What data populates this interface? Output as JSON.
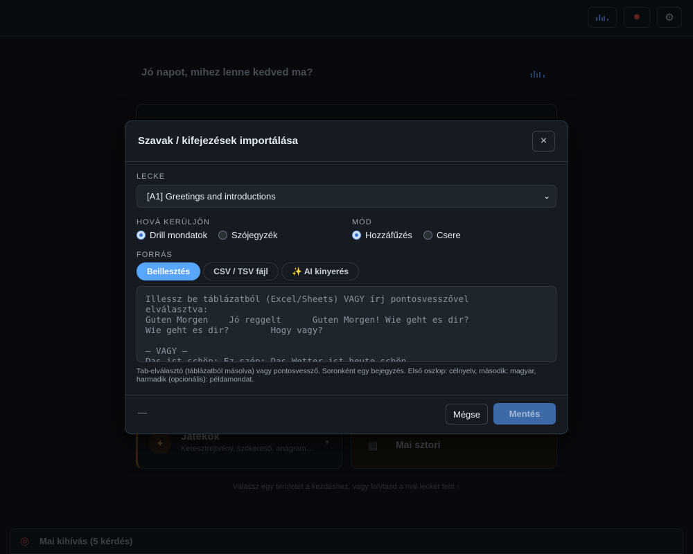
{
  "header": {
    "buttons": [
      {
        "name": "stats-button",
        "icon": "bar-chart-icon"
      },
      {
        "name": "bug-report-button",
        "icon": "bug-icon"
      },
      {
        "name": "settings-button",
        "icon": "gear-icon"
      }
    ]
  },
  "home": {
    "greeting": "Jó napot, mihez lenne kedved ma?",
    "games_card": {
      "title": "Játékok",
      "subtitle": "Keresztrejtvény, szókereső, anagramma",
      "icon": "sparkle-icon"
    },
    "story_card": {
      "title": "Mai sztori",
      "icon": "newspaper-icon"
    },
    "hint": "Válassz egy területet a kezdéshez, vagy folytasd a mai leckét fent ↑",
    "daily_challenge": {
      "label": "Mai kihívás (5 kérdés)",
      "icon": "target-icon"
    }
  },
  "modal": {
    "title": "Szavak / kifejezések importálása",
    "close_label": "×",
    "lesson_label": "LECKE",
    "lesson_value": "[A1] Greetings and introductions",
    "destination_label": "HOVÁ KERÜLJÖN",
    "destination_options": [
      "Drill mondatok",
      "Szójegyzék"
    ],
    "destination_selected": "Drill mondatok",
    "mode_label": "MÓD",
    "mode_options": [
      "Hozzáfűzés",
      "Csere"
    ],
    "mode_selected": "Hozzáfűzés",
    "source_label": "FORRÁS",
    "source_tabs": [
      "Beillesztés",
      "CSV / TSV fájl",
      "✨ AI kinyerés"
    ],
    "source_active": "Beillesztés",
    "textarea_placeholder": "Illessz be táblázatból (Excel/Sheets) VAGY írj pontosvesszővel\nelválasztva:\nGuten Morgen    Jó reggelt      Guten Morgen! Wie geht es dir?\nWie geht es dir?        Hogy vagy?\n\n— VAGY —\nDas ist schön; Ez szép; Das Wetter ist heute schön",
    "help_text": "Tab-elválasztó (táblázatból másolva) vagy pontosvessző. Soronként egy bejegyzés. Első oszlop: célnyelv, második: magyar, harmadik (opcionális): példamondat.",
    "footer_status": "—",
    "cancel_label": "Mégse",
    "save_label": "Mentés"
  }
}
